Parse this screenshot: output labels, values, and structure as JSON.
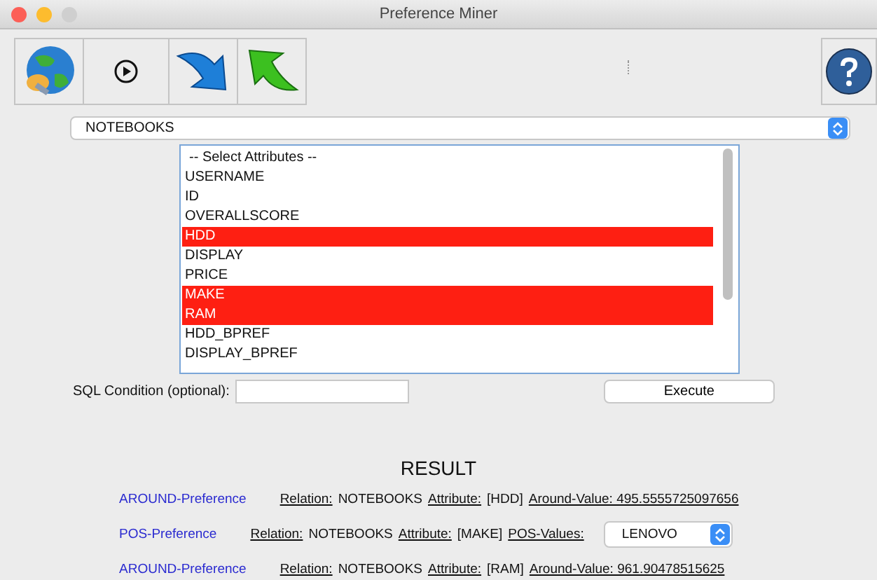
{
  "window": {
    "title": "Preference Miner"
  },
  "relation_select": {
    "value": "NOTEBOOKS"
  },
  "attributes": [
    {
      "label": "-- Select Attributes --",
      "selected": false
    },
    {
      "label": "USERNAME",
      "selected": false
    },
    {
      "label": "ID",
      "selected": false
    },
    {
      "label": "OVERALLSCORE",
      "selected": false
    },
    {
      "label": "HDD",
      "selected": true
    },
    {
      "label": "DISPLAY",
      "selected": false
    },
    {
      "label": "PRICE",
      "selected": false
    },
    {
      "label": "MAKE",
      "selected": true
    },
    {
      "label": "RAM",
      "selected": true
    },
    {
      "label": "HDD_BPREF",
      "selected": false
    },
    {
      "label": "DISPLAY_BPREF",
      "selected": false
    }
  ],
  "sql_condition": {
    "label": "SQL Condition (optional):"
  },
  "execute_button": "Execute",
  "result": {
    "title": "RESULT",
    "rows": [
      {
        "kind": "around",
        "preference": "AROUND-Preference",
        "relation_label": "Relation:",
        "relation": "NOTEBOOKS",
        "attribute_label": "Attribute:",
        "attribute": "[HDD]",
        "value": "Around-Value: 495.5555725097656"
      },
      {
        "kind": "pos",
        "preference": "POS-Preference",
        "relation_label": "Relation:",
        "relation": "NOTEBOOKS",
        "attribute_label": "Attribute:",
        "attribute": "[MAKE]",
        "value_label": "POS-Values:",
        "value": "LENOVO"
      },
      {
        "kind": "around",
        "preference": "AROUND-Preference",
        "relation_label": "Relation:",
        "relation": "NOTEBOOKS",
        "attribute_label": "Attribute:",
        "attribute": "[RAM]",
        "value": "Around-Value: 961.90478515625"
      }
    ]
  }
}
